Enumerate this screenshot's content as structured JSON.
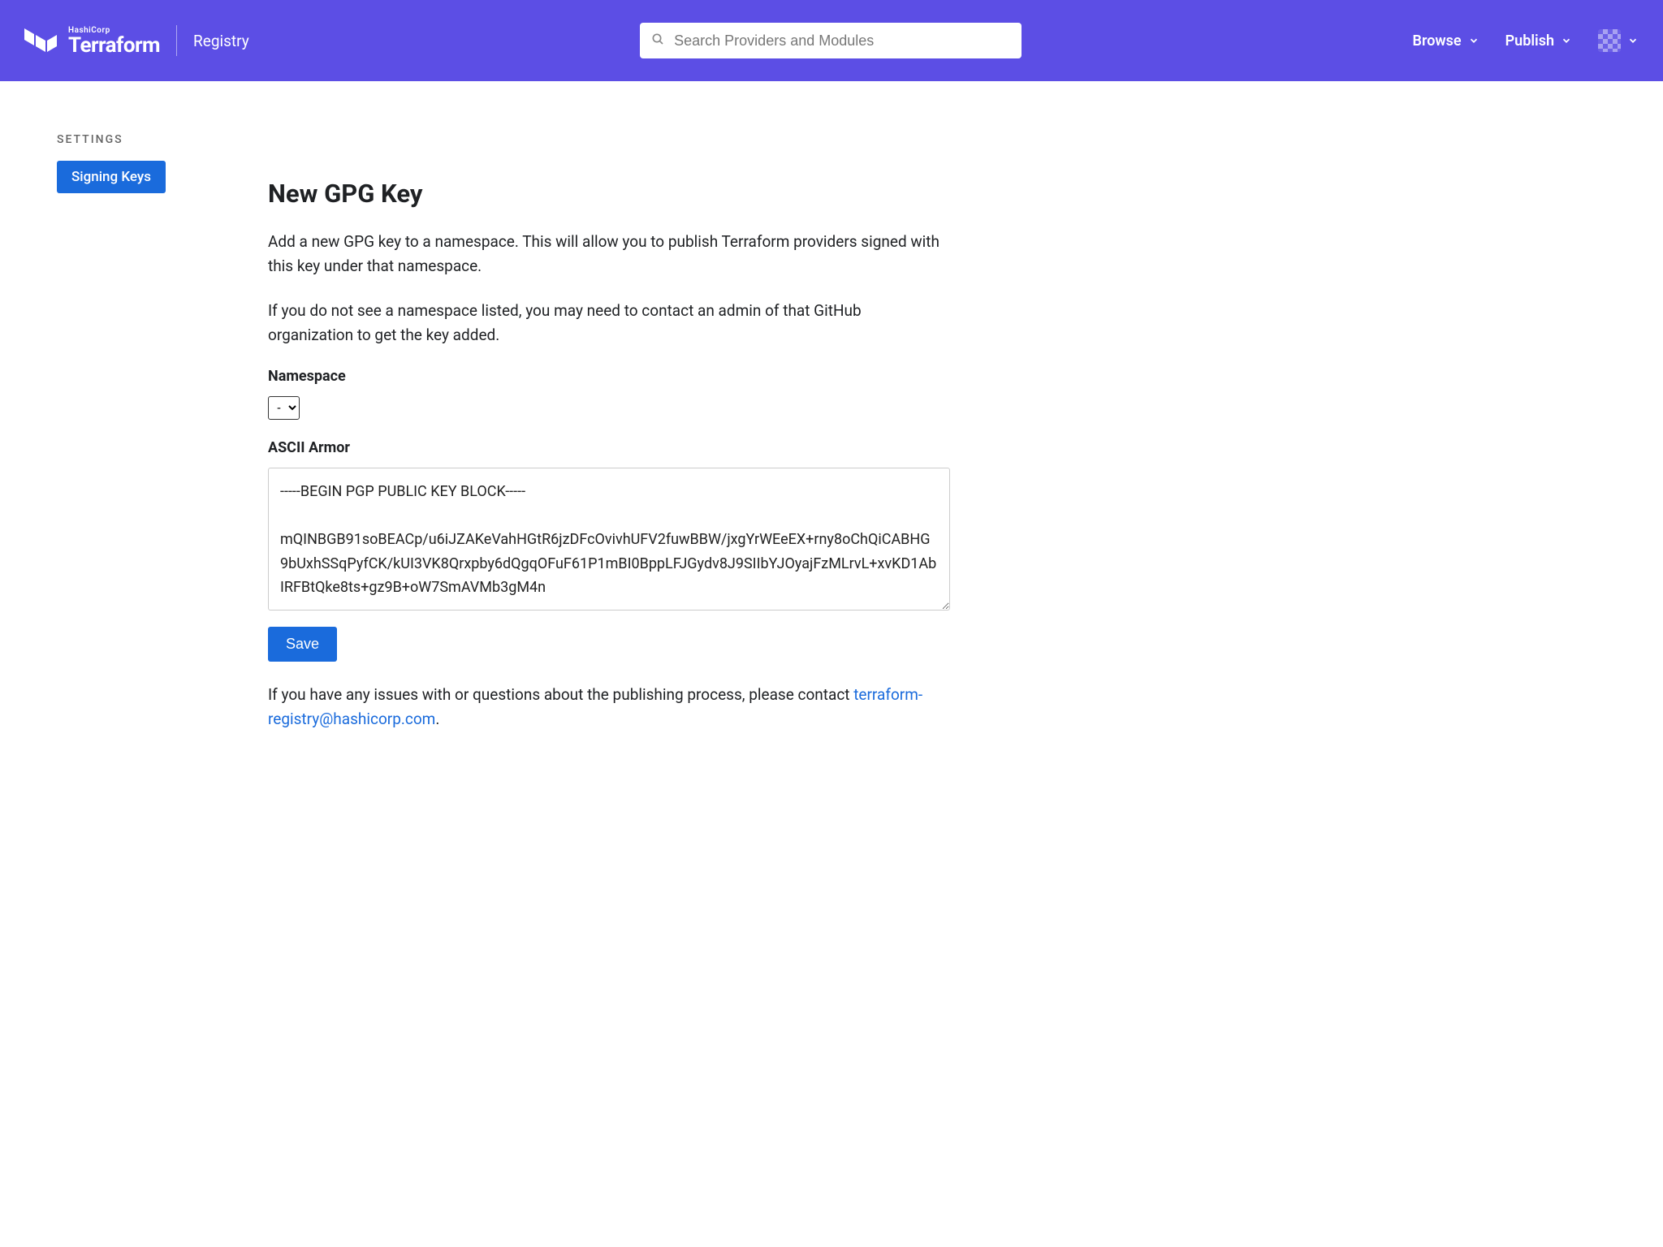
{
  "header": {
    "brand_small": "HashiCorp",
    "brand_main": "Terraform",
    "brand_sub": "Registry",
    "search_placeholder": "Search Providers and Modules",
    "nav_browse": "Browse",
    "nav_publish": "Publish"
  },
  "sidebar": {
    "heading": "SETTINGS",
    "items": [
      {
        "label": "Signing Keys",
        "active": true
      }
    ]
  },
  "main": {
    "title": "New GPG Key",
    "desc1": "Add a new GPG key to a namespace. This will allow you to publish Terraform providers signed with this key under that namespace.",
    "desc2": "If you do not see a namespace listed, you may need to contact an admin of that GitHub organization to get the key added.",
    "namespace_label": "Namespace",
    "namespace_value": "-",
    "ascii_label": "ASCII Armor",
    "ascii_value": "-----BEGIN PGP PUBLIC KEY BLOCK-----\n\nmQINBGB91soBEACp/u6iJZAKeVahHGtR6jzDFcOvivhUFV2fuwBBW/jxgYrWEeEX+rny8oChQiCABHG9bUxhSSqPyfCK/kUI3VK8Qrxpby6dQgqOFuF61P1mBI0BppLFJGydv8J9SIIbYJOyajFzMLrvL+xvKD1AbIRFBtQke8ts+gz9B+oW7SmAVMb3gM4n",
    "save_label": "Save",
    "footer_text": "If you have any issues with or questions about the publishing process, please contact ",
    "footer_email": "terraform-registry@hashicorp.com",
    "footer_period": "."
  }
}
